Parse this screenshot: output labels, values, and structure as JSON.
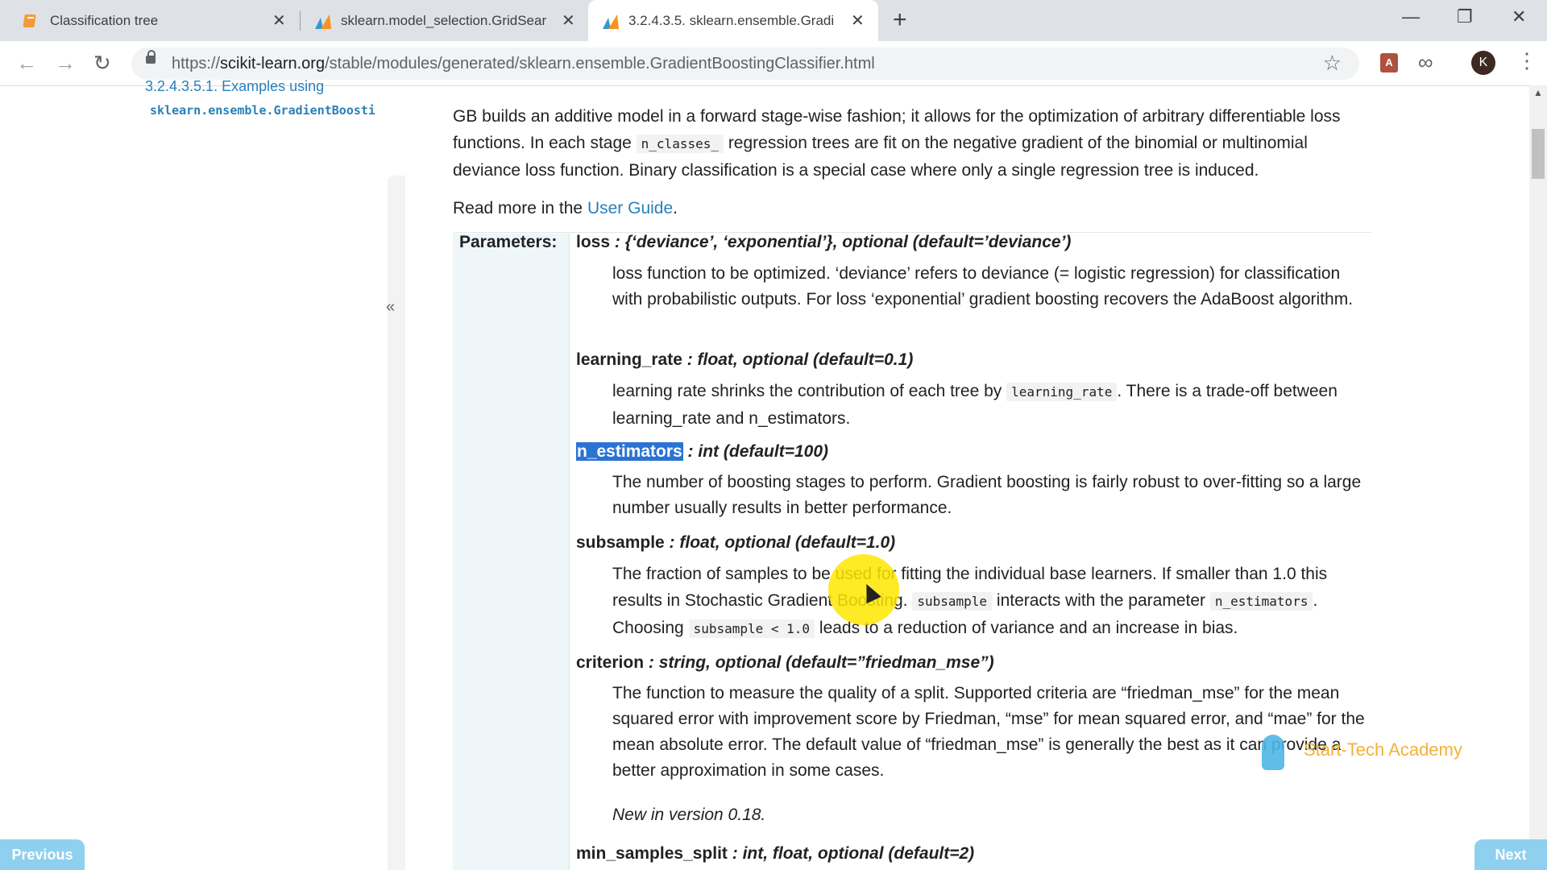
{
  "tabs": [
    {
      "title": "Classification tree",
      "icon": "book-icon",
      "color": "#f29b38"
    },
    {
      "title": "sklearn.model_selection.GridSear",
      "icon": "sklearn-icon",
      "color": "#f7931e"
    },
    {
      "title": "3.2.4.3.5. sklearn.ensemble.Gradi",
      "icon": "sklearn-icon",
      "color": "#f7931e",
      "active": true
    }
  ],
  "address_bar": {
    "scheme": "https://",
    "host": "scikit-learn.org",
    "path": "/stable/modules/generated/sklearn.ensemble.GradientBoostingClassifier.html"
  },
  "toolbar": {
    "avatar_letter": "K"
  },
  "sidebar": {
    "link1": "3.2.4.3.5.1. Examples using",
    "link2": "sklearn.ensemble.GradientBoosti",
    "collapse": "«"
  },
  "intro": {
    "p1_a": "GB builds an additive model in a forward stage-wise fashion; it allows for the optimization of arbitrary differentiable loss functions. In each stage ",
    "p1_code": "n_classes_",
    "p1_b": " regression trees are fit on the negative gradient of the binomial or multinomial deviance loss function. Binary classification is a special case where only a single regression tree is induced.",
    "read_more": "Read more in the ",
    "user_guide": "User Guide",
    "period": "."
  },
  "params_label": "Parameters:",
  "params": {
    "loss": {
      "name": "loss",
      "type": " : {‘deviance’, ‘exponential’}, optional (default=’deviance’)",
      "desc": "loss function to be optimized. ‘deviance’ refers to deviance (= logistic regression) for classification with probabilistic outputs. For loss ‘exponential’ gradient boosting recovers the AdaBoost algorithm."
    },
    "learning_rate": {
      "name": "learning_rate",
      "type": " : float, optional (default=0.1)",
      "desc_a": "learning rate shrinks the contribution of each tree by ",
      "desc_code": "learning_rate",
      "desc_b": ". There is a trade-off between learning_rate and n_estimators."
    },
    "n_estimators": {
      "name": "n_estimators",
      "type": " : int (default=100)",
      "desc": "The number of boosting stages to perform. Gradient boosting is fairly robust to over-fitting so a large number usually results in better performance."
    },
    "subsample": {
      "name": "subsample",
      "type": " : float, optional (default=1.0)",
      "desc_a": "The fraction of samples to be used for fitting the individual base learners. If smaller than 1.0 this results in Stochastic Gradient Boosting. ",
      "desc_code1": "subsample",
      "desc_b": " interacts with the parameter ",
      "desc_code2": "n_estimators",
      "desc_c": ". Choosing ",
      "desc_code3": "subsample < 1.0",
      "desc_d": " leads to a reduction of variance and an increase in bias."
    },
    "criterion": {
      "name": "criterion",
      "type": " : string, optional (default=”friedman_mse”)",
      "desc": "The function to measure the quality of a split. Supported criteria are “friedman_mse” for the mean squared error with improvement score by Friedman, “mse” for mean squared error, and “mae” for the mean absolute error. The default value of “friedman_mse” is generally the best as it can provide a better approximation in some cases.",
      "version": "New in version 0.18."
    },
    "min_samples_split": {
      "name": "min_samples_split",
      "type": " : int, float, optional (default=2)"
    }
  },
  "watermark": "Start-Tech Academy",
  "player": {
    "previous": "Previous",
    "next": "Next"
  }
}
